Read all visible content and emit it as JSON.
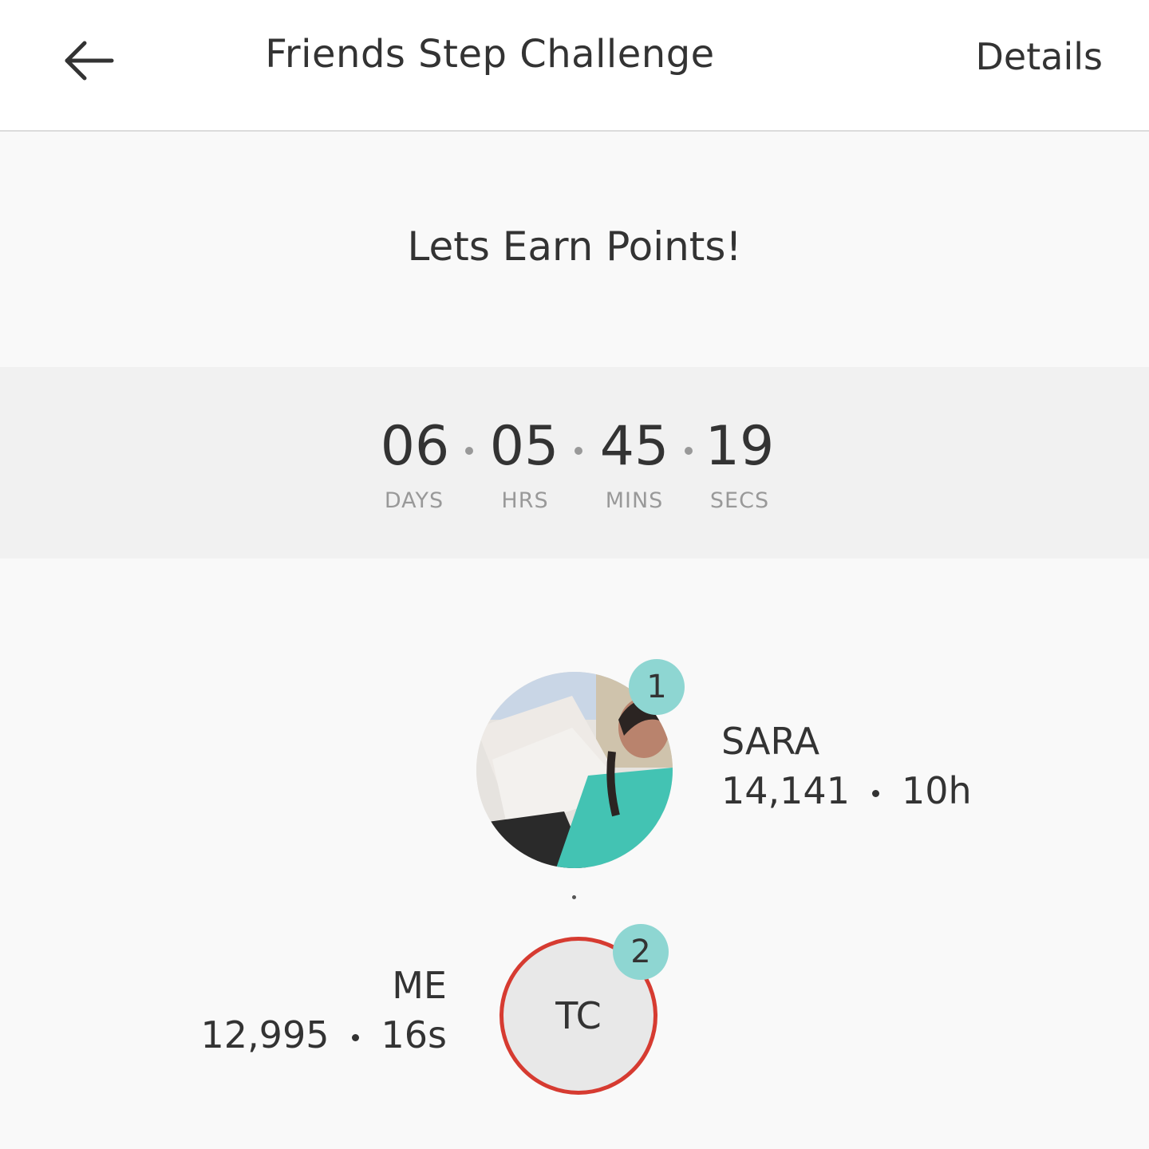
{
  "header": {
    "back_icon": "arrow-left-icon",
    "title": "Friends Step Challenge",
    "details_label": "Details"
  },
  "subtitle": "Lets Earn Points!",
  "countdown": {
    "days": "06",
    "hours": "05",
    "mins": "45",
    "secs": "19",
    "days_label": "DAYS",
    "hours_label": "HRS",
    "mins_label": "MINS",
    "secs_label": "SECS"
  },
  "leaderboard": [
    {
      "rank": "1",
      "name": "SARA",
      "steps": "14,141",
      "time": "10h",
      "avatar": "photo"
    },
    {
      "rank": "2",
      "name": "ME",
      "steps": "12,995",
      "time": "16s",
      "initials": "TC"
    }
  ],
  "colors": {
    "rank_badge": "#8ed6d2",
    "me_ring": "#d63b31",
    "timer_band": "#f1f1f1"
  }
}
